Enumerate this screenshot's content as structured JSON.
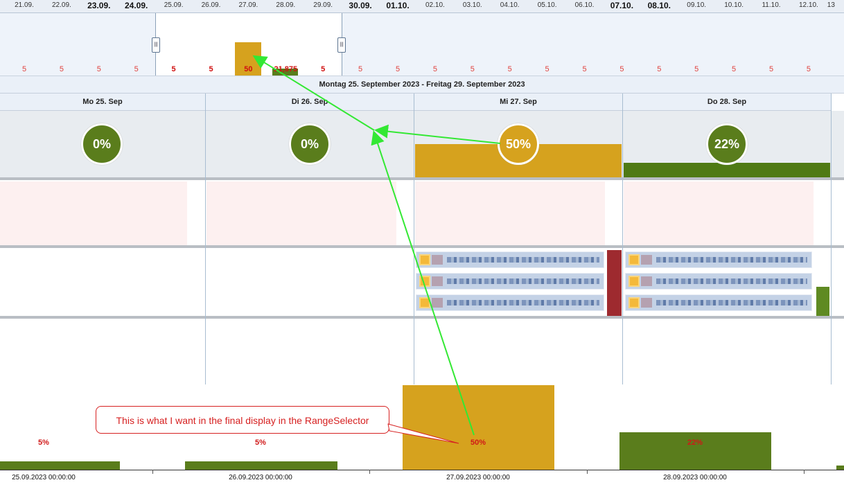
{
  "range_selector": {
    "dates": [
      {
        "label": "21.09.",
        "bold": false
      },
      {
        "label": "22.09.",
        "bold": false
      },
      {
        "label": "23.09.",
        "bold": true
      },
      {
        "label": "24.09.",
        "bold": true
      },
      {
        "label": "25.09.",
        "bold": false
      },
      {
        "label": "26.09.",
        "bold": false
      },
      {
        "label": "27.09.",
        "bold": false
      },
      {
        "label": "28.09.",
        "bold": false
      },
      {
        "label": "29.09.",
        "bold": false
      },
      {
        "label": "30.09.",
        "bold": true
      },
      {
        "label": "01.10.",
        "bold": true
      },
      {
        "label": "02.10.",
        "bold": false
      },
      {
        "label": "03.10.",
        "bold": false
      },
      {
        "label": "04.10.",
        "bold": false
      },
      {
        "label": "05.10.",
        "bold": false
      },
      {
        "label": "06.10.",
        "bold": false
      },
      {
        "label": "07.10.",
        "bold": true
      },
      {
        "label": "08.10.",
        "bold": true
      },
      {
        "label": "09.10.",
        "bold": false
      },
      {
        "label": "10.10.",
        "bold": false
      },
      {
        "label": "11.10.",
        "bold": false
      },
      {
        "label": "12.10.",
        "bold": false
      },
      {
        "label": "13",
        "bold": false
      }
    ],
    "values": [
      {
        "label": "5",
        "bold": false
      },
      {
        "label": "5",
        "bold": false
      },
      {
        "label": "5",
        "bold": false
      },
      {
        "label": "5",
        "bold": false
      },
      {
        "label": "5",
        "bold": true
      },
      {
        "label": "5",
        "bold": true
      },
      {
        "label": "50",
        "bold": true
      },
      {
        "label": "21,875",
        "bold": true
      },
      {
        "label": "5",
        "bold": true
      },
      {
        "label": "5",
        "bold": false
      },
      {
        "label": "5",
        "bold": false
      },
      {
        "label": "5",
        "bold": false
      },
      {
        "label": "5",
        "bold": false
      },
      {
        "label": "5",
        "bold": false
      },
      {
        "label": "5",
        "bold": false
      },
      {
        "label": "5",
        "bold": false
      },
      {
        "label": "5",
        "bold": false
      },
      {
        "label": "5",
        "bold": false
      },
      {
        "label": "5",
        "bold": false
      },
      {
        "label": "5",
        "bold": false
      },
      {
        "label": "5",
        "bold": false
      },
      {
        "label": "5",
        "bold": false
      }
    ],
    "handle_glyph": "|||"
  },
  "week_header": "Montag 25. September 2023 - Freitag 29. September 2023",
  "days": [
    {
      "label": "Mo 25. Sep",
      "load": "0%",
      "load_fraction": 0,
      "gauge_color": "#5a7d1c",
      "bar_color": "#5a7d1c"
    },
    {
      "label": "Di 26. Sep",
      "load": "0%",
      "load_fraction": 0,
      "gauge_color": "#5a7d1c",
      "bar_color": "#5a7d1c"
    },
    {
      "label": "Mi 27. Sep",
      "load": "50%",
      "load_fraction": 0.5,
      "gauge_color": "#d6a21e",
      "bar_color": "#d6a21e"
    },
    {
      "label": "Do 28. Sep",
      "load": "22%",
      "load_fraction": 0.22,
      "gauge_color": "#5a7d1c",
      "bar_color": "#4f7a14"
    }
  ],
  "colors": {
    "green": "#5a7d1c",
    "amber": "#d6a21e",
    "red_marker": "#9e2a2f",
    "arrow": "#33e833",
    "label_red": "#d01818"
  },
  "callout": "This is what I want in the final display in the RangeSelector",
  "bottom_chart": {
    "x_labels": [
      "25.09.2023 00:00:00",
      "26.09.2023 00:00:00",
      "27.09.2023 00:00:00",
      "28.09.2023 00:00:00"
    ],
    "bar_labels": [
      "5%",
      "5%",
      "50%",
      "22%"
    ],
    "values": [
      5,
      5,
      50,
      22
    ]
  }
}
